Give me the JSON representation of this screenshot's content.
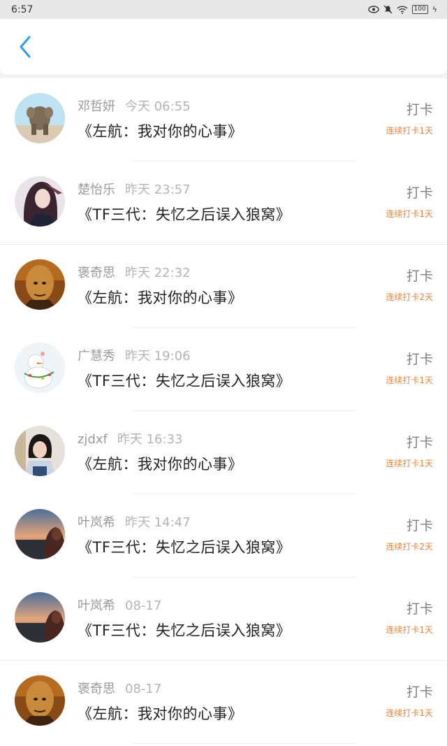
{
  "status_bar": {
    "time": "6:57",
    "battery": "100"
  },
  "header": {
    "back_icon": "chevron-left-icon"
  },
  "colors": {
    "accent_blue": "#2d9cf0",
    "streak_orange": "#e8843b"
  },
  "records": [
    {
      "name": "邓哲妍",
      "time": "今天 06:55",
      "book": "《左航：我对你的心事》",
      "action": "打卡",
      "streak": "连续打卡1天",
      "avatar": "elephant"
    },
    {
      "name": "楚怡乐",
      "time": "昨天 23:57",
      "book": "《TF三代：失忆之后误入狼窝》",
      "action": "打卡",
      "streak": "连续打卡1天",
      "avatar": "anime-girl"
    },
    {
      "name": "褒奇思",
      "time": "昨天 22:32",
      "book": "《左航：我对你的心事》",
      "action": "打卡",
      "streak": "连续打卡2天",
      "avatar": "bald-man"
    },
    {
      "name": "广慧秀",
      "time": "昨天 19:06",
      "book": "《TF三代：失忆之后误入狼窝》",
      "action": "打卡",
      "streak": "连续打卡1天",
      "avatar": "snowman"
    },
    {
      "name": "zjdxf",
      "time": "昨天 16:33",
      "book": "《左航：我对你的心事》",
      "action": "打卡",
      "streak": "连续打卡1天",
      "avatar": "girl"
    },
    {
      "name": "叶岚希",
      "time": "昨天 14:47",
      "book": "《TF三代：失忆之后误入狼窝》",
      "action": "打卡",
      "streak": "连续打卡2天",
      "avatar": "sunset"
    },
    {
      "name": "叶岚希",
      "time": "08-17",
      "book": "《TF三代：失忆之后误入狼窝》",
      "action": "打卡",
      "streak": "连续打卡1天",
      "avatar": "sunset"
    },
    {
      "name": "褒奇思",
      "time": "08-17",
      "book": "《左航：我对你的心事》",
      "action": "打卡",
      "streak": "连续打卡1天",
      "avatar": "bald-man"
    }
  ]
}
